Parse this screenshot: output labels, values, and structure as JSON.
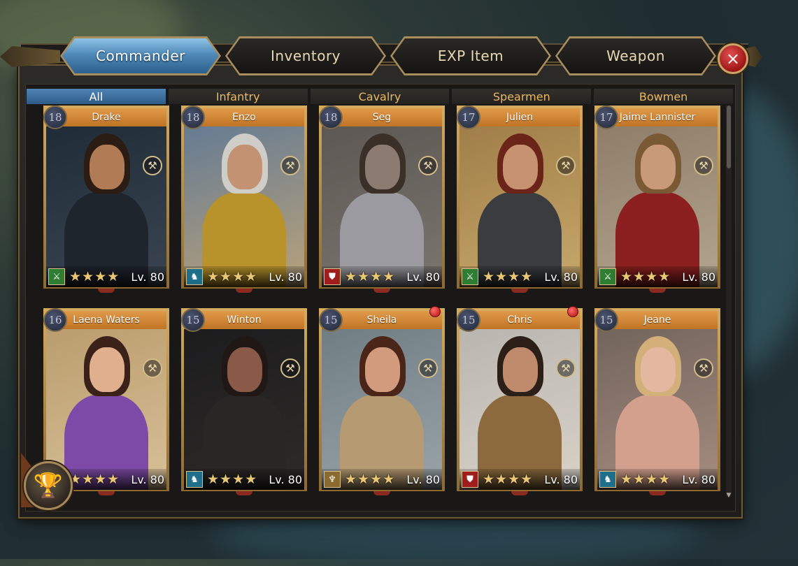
{
  "tabs": [
    {
      "label": "Commander",
      "active": true
    },
    {
      "label": "Inventory",
      "active": false
    },
    {
      "label": "EXP Item",
      "active": false
    },
    {
      "label": "Weapon",
      "active": false
    }
  ],
  "close_icon": "×",
  "filters": [
    {
      "label": "All",
      "active": true
    },
    {
      "label": "Infantry",
      "active": false
    },
    {
      "label": "Cavalry",
      "active": false
    },
    {
      "label": "Spearmen",
      "active": false
    },
    {
      "label": "Bowmen",
      "active": false
    }
  ],
  "commanders": [
    {
      "name": "Drake",
      "badge": "18",
      "level": "Lv. 80",
      "stars": "★★★★",
      "type": "spearmen",
      "type_glyph": "⚔",
      "type_color": "#2e7d32",
      "notify": false,
      "palette": {
        "bg1": "#1d2a36",
        "bg2": "#3a4550",
        "skin": "#b07b55",
        "hair": "#2b1d14",
        "body": "#1f252d"
      }
    },
    {
      "name": "Enzo",
      "badge": "18",
      "level": "Lv. 80",
      "stars": "★★★★",
      "type": "cavalry",
      "type_glyph": "♞",
      "type_color": "#1f6f8b",
      "notify": false,
      "palette": {
        "bg1": "#5e7895",
        "bg2": "#b9a27a",
        "skin": "#c29273",
        "hair": "#cfcdc8",
        "body": "#b8922a"
      }
    },
    {
      "name": "Seg",
      "badge": "18",
      "level": "Lv. 80",
      "stars": "★★★★",
      "type": "infantry",
      "type_glyph": "⛊",
      "type_color": "#a01d1d",
      "notify": false,
      "palette": {
        "bg1": "#5a5550",
        "bg2": "#7b7570",
        "skin": "#8c7b70",
        "hair": "#3b3028",
        "body": "#9a9aa0"
      }
    },
    {
      "name": "Julien",
      "badge": "17",
      "level": "Lv. 80",
      "stars": "★★★★",
      "type": "spearmen",
      "type_glyph": "⚔",
      "type_color": "#2e7d32",
      "notify": false,
      "palette": {
        "bg1": "#9d7a46",
        "bg2": "#c7a86a",
        "skin": "#c79270",
        "hair": "#6b2418",
        "body": "#3a3c40"
      }
    },
    {
      "name": "Jaime Lannister",
      "badge": "17",
      "level": "Lv. 80",
      "stars": "★★★★",
      "type": "spearmen",
      "type_glyph": "⚔",
      "type_color": "#2e7d32",
      "notify": false,
      "palette": {
        "bg1": "#8a7a66",
        "bg2": "#b4a58e",
        "skin": "#c89a7a",
        "hair": "#7a5a35",
        "body": "#8c1f1f"
      }
    },
    {
      "name": "Laena Waters",
      "badge": "16",
      "level": "Lv. 80",
      "stars": "★★★★",
      "type": "bowmen",
      "type_glyph": "♆",
      "type_color": "#8a6a2e",
      "notify": false,
      "palette": {
        "bg1": "#b89a6a",
        "bg2": "#d8c098",
        "skin": "#e0b08e",
        "hair": "#3a2218",
        "body": "#7d4aa8"
      }
    },
    {
      "name": "Winton",
      "badge": "15",
      "level": "Lv. 80",
      "stars": "★★★★",
      "type": "cavalry",
      "type_glyph": "♞",
      "type_color": "#1f6f8b",
      "notify": false,
      "palette": {
        "bg1": "#1b1b1d",
        "bg2": "#2e2a28",
        "skin": "#8a5a48",
        "hair": "#201815",
        "body": "#2a2626"
      }
    },
    {
      "name": "Sheila",
      "badge": "15",
      "level": "Lv. 80",
      "stars": "★★★★",
      "type": "bowmen",
      "type_glyph": "♆",
      "type_color": "#8a6a2e",
      "notify": true,
      "palette": {
        "bg1": "#6c7a80",
        "bg2": "#9aa4a8",
        "skin": "#d29b7e",
        "hair": "#4a2518",
        "body": "#b69b72"
      }
    },
    {
      "name": "Chris",
      "badge": "15",
      "level": "Lv. 80",
      "stars": "★★★★",
      "type": "infantry",
      "type_glyph": "⛊",
      "type_color": "#a01d1d",
      "notify": true,
      "palette": {
        "bg1": "#b7b3ad",
        "bg2": "#d8d2c8",
        "skin": "#c08a6c",
        "hair": "#2b1f18",
        "body": "#8c6a3e"
      }
    },
    {
      "name": "Jeane",
      "badge": "15",
      "level": "Lv. 80",
      "stars": "★★★★",
      "type": "cavalry",
      "type_glyph": "♞",
      "type_color": "#1f6f8b",
      "notify": false,
      "palette": {
        "bg1": "#6e6158",
        "bg2": "#a58c80",
        "skin": "#e3b7a0",
        "hair": "#d3b07a",
        "body": "#d4a08e"
      }
    }
  ],
  "equip_icon": "⚒",
  "bottom_corner_icon": "goblet-icon"
}
